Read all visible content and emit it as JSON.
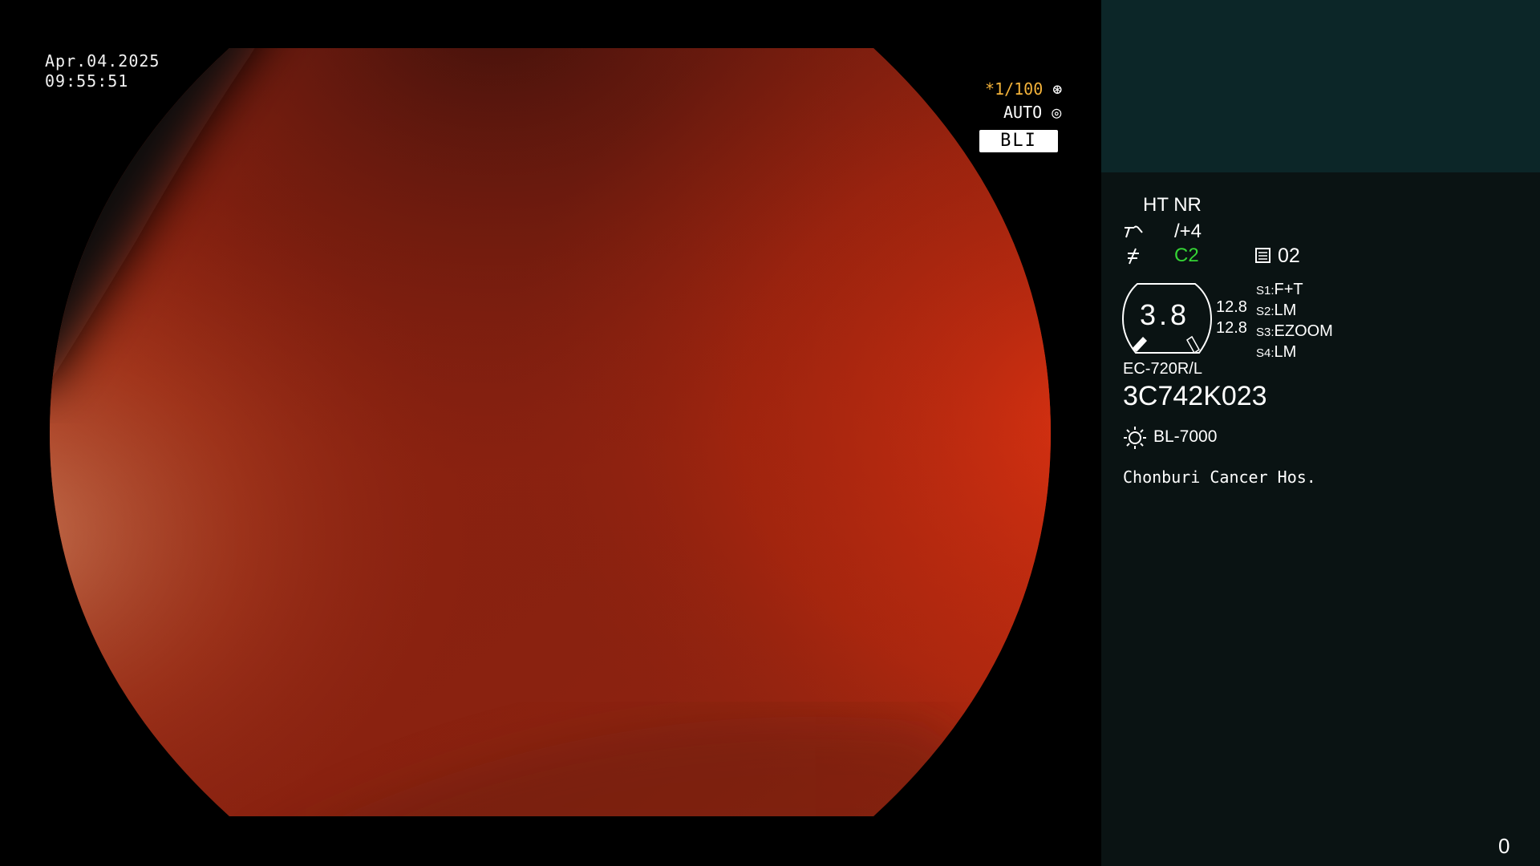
{
  "overlay": {
    "date": "Apr.04.2025",
    "time": "09:55:51",
    "shutter": "*1/100",
    "shutter_icon": "shutter-icon",
    "iris": "AUTO",
    "iris_icon": "iris-icon",
    "mode": "BLI"
  },
  "panel": {
    "labels": "HT NR",
    "ht_value": "/+4",
    "nr_value": "C2",
    "nr_color": "#35d435",
    "preset_value": "02",
    "zoom_value": "3.8",
    "pressure_1": "12.8",
    "pressure_2": "12.8",
    "switches": [
      {
        "key": "S1:",
        "value": "F+T"
      },
      {
        "key": "S2:",
        "value": "LM"
      },
      {
        "key": "S3:",
        "value": "EZOOM"
      },
      {
        "key": "S4:",
        "value": "LM"
      }
    ],
    "scope_model": "EC-720R/L",
    "scope_serial": "3C742K023",
    "light_source": "BL-7000",
    "hospital": "Chonburi Cancer Hos.",
    "counter": "0"
  },
  "colors": {
    "panel_bg": "#0a1313",
    "panel_top_bg": "#0c2628",
    "shutter_color": "#f3b23a",
    "tissue": "#a32812"
  }
}
